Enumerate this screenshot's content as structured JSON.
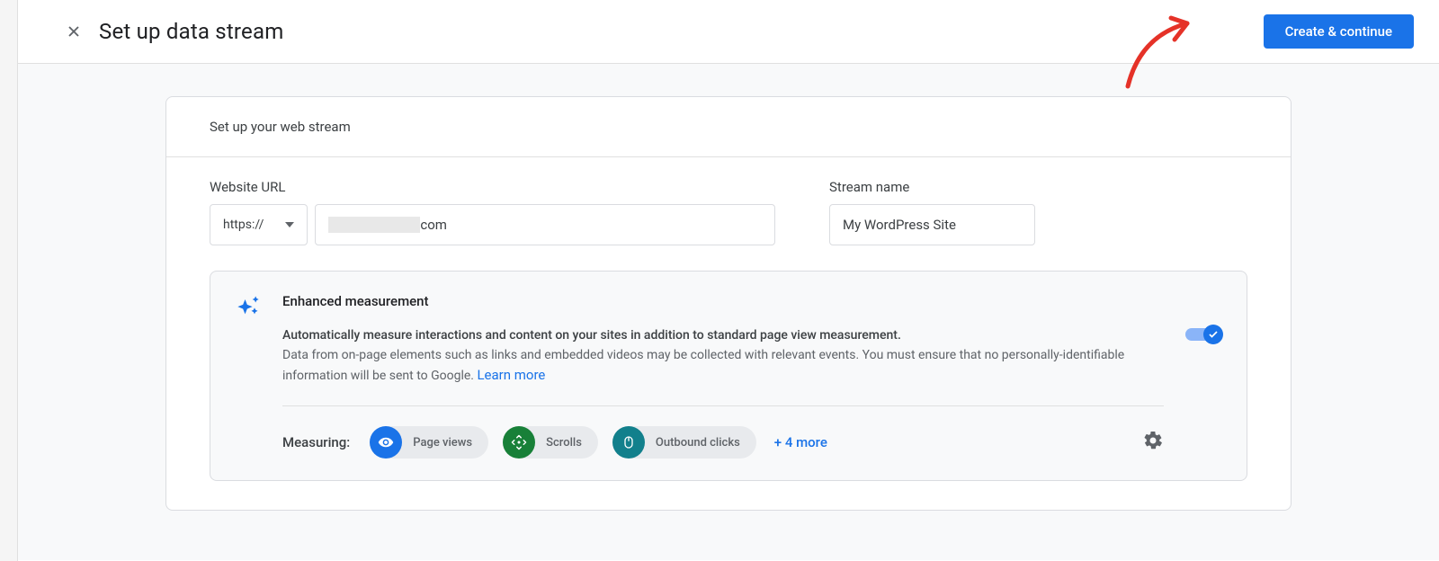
{
  "header": {
    "title": "Set up data stream",
    "primary_button": "Create & continue"
  },
  "card": {
    "header_text": "Set up your web stream",
    "website_url_label": "Website URL",
    "stream_name_label": "Stream name",
    "protocol_value": "https://",
    "url_suffix": "com",
    "stream_name_value": "My WordPress Site"
  },
  "enhanced": {
    "title": "Enhanced measurement",
    "desc_bold": "Automatically measure interactions and content on your sites in addition to standard page view measurement.",
    "desc": "Data from on-page elements such as links and embedded videos may be collected with relevant events. You must ensure that no personally-identifiable information will be sent to Google. ",
    "learn_more": "Learn more",
    "measuring_label": "Measuring:",
    "chips": {
      "page_views": "Page views",
      "scrolls": "Scrolls",
      "outbound": "Outbound clicks"
    },
    "more": "+ 4 more",
    "toggle_on": true
  }
}
